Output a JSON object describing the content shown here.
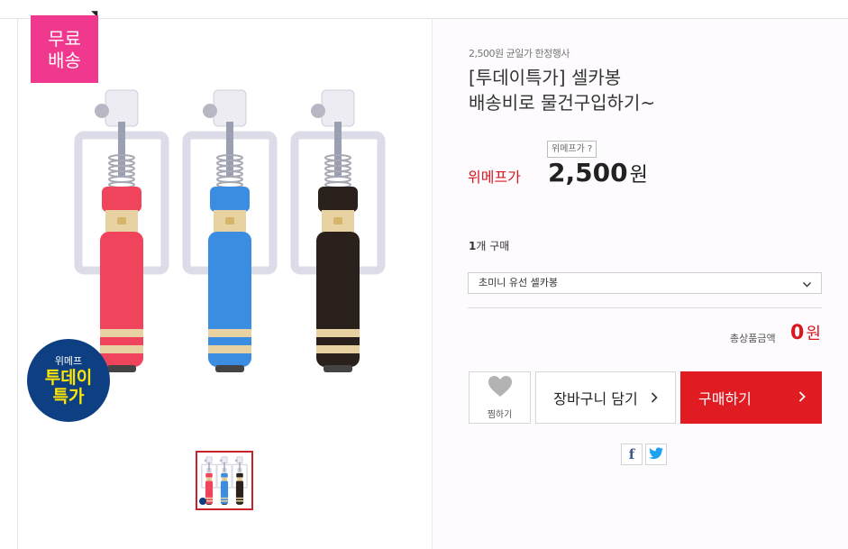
{
  "badges": {
    "free_shipping": [
      "무료",
      "배송"
    ],
    "today_small": "위메프",
    "today_big": [
      "투데이",
      "특가"
    ]
  },
  "product": {
    "subtitle": "2,500원 균일가 한정행사",
    "title_line1": "[투데이특가] 셀카봉",
    "title_line2": "배송비로 물건구입하기~",
    "price_tooltip": "위메프가 ?",
    "price_label": "위메프가",
    "price_value": "2,500",
    "price_unit": "원",
    "qty_number": "1",
    "qty_suffix": "개 구매",
    "option_selected": "초미니 유선 셀카봉",
    "total_label": "총상품금액",
    "total_value": "0",
    "total_unit": "원"
  },
  "actions": {
    "wish_label": "찜하기",
    "cart_label": "장바구니 담기",
    "buy_label": "구매하기"
  },
  "share": {
    "facebook": "f"
  },
  "colors": {
    "accent_red": "#e01b22",
    "pink_badge": "#f0388e",
    "navy_badge": "#0f3f83",
    "stick_colors": [
      "#f0445c",
      "#3a8de0",
      "#2a211c"
    ]
  }
}
